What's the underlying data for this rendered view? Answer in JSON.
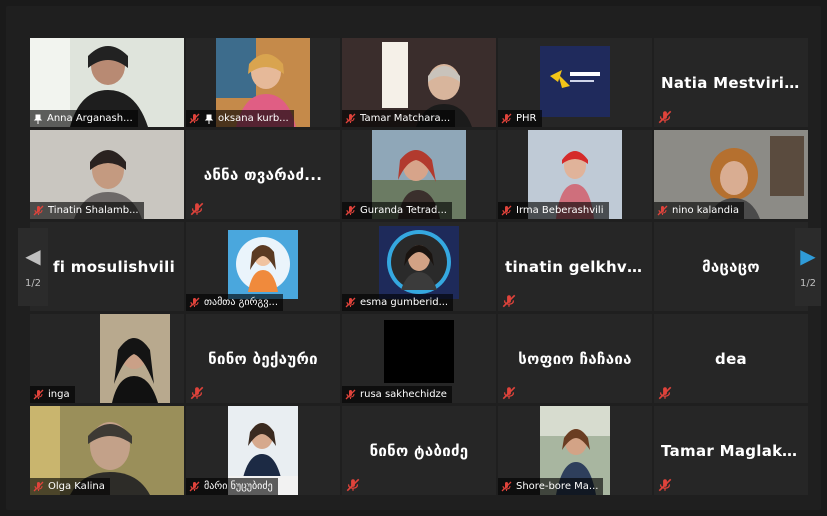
{
  "pagination": {
    "left_page": "1/2",
    "right_page": "1/2"
  },
  "colors": {
    "active_border": "#c8d94b",
    "accent": "#2f9bd8",
    "muted": "#e0433b"
  },
  "tiles": [
    {
      "name": "Anna Arganash...",
      "type": "video",
      "pinned": true
    },
    {
      "name": "oksana kurb...",
      "type": "video",
      "pinned": true
    },
    {
      "name": "Tamar Matchara...",
      "type": "video"
    },
    {
      "name": "PHR",
      "type": "logo"
    },
    {
      "name": "Natia  Mestviris...",
      "type": "text"
    },
    {
      "name": "Tinatin Shalamb...",
      "type": "video"
    },
    {
      "name": "ანნა თვარაძ...",
      "type": "text"
    },
    {
      "name": "Guranda Tetrad...",
      "type": "video"
    },
    {
      "name": "Irma Beberashvili",
      "type": "video"
    },
    {
      "name": "nino kalandia",
      "type": "video"
    },
    {
      "name": "fi mosulishvili",
      "type": "text"
    },
    {
      "name": "თამთა გირგვ...",
      "type": "avatar"
    },
    {
      "name": "esma gumberid...",
      "type": "avatar"
    },
    {
      "name": "tinatin  gelkhvii...",
      "type": "text"
    },
    {
      "name": "მაცაცო",
      "type": "text"
    },
    {
      "name": "inga",
      "type": "video"
    },
    {
      "name": "ნინო ბექაური",
      "type": "text"
    },
    {
      "name": "rusa sakhechidze",
      "type": "black"
    },
    {
      "name": "სოფიო ჩაჩაია",
      "type": "text"
    },
    {
      "name": "dea",
      "type": "text"
    },
    {
      "name": "Olga Kalina",
      "type": "video"
    },
    {
      "name": "მარი ნუცუბიძე",
      "type": "video"
    },
    {
      "name": "ნინო ტაბიძე",
      "type": "text"
    },
    {
      "name": "Shore-bore Ma...",
      "type": "video"
    },
    {
      "name": "Tamar  Maglakel...",
      "type": "text"
    }
  ]
}
